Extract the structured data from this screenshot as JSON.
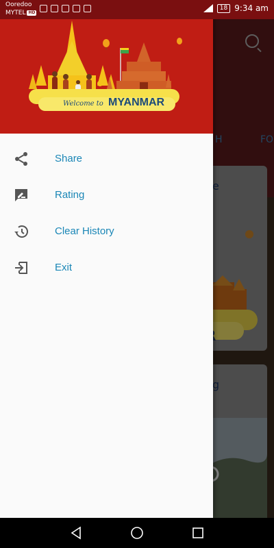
{
  "status_bar": {
    "carrier_1": "Ooredoo",
    "carrier_2": "MYTEL",
    "carrier_2_tag": "HD",
    "battery": "18",
    "time": "9:34 am"
  },
  "header": {
    "banner_script": "Welcome to",
    "banner_title": "MYANMAR"
  },
  "menu": {
    "items": [
      {
        "label": "Share",
        "icon": "share-icon"
      },
      {
        "label": "Rating",
        "icon": "rating-icon"
      },
      {
        "label": "Clear History",
        "icon": "history-icon"
      },
      {
        "label": "Exit",
        "icon": "exit-icon"
      }
    ]
  },
  "background": {
    "tab_partial_1": "H",
    "tab_partial_2": "FO",
    "card1_partial": "e",
    "card1_banner_partial": "R",
    "card2_partial": "g"
  },
  "colors": {
    "header_red": "#c01d14",
    "accent_blue": "#1a86b6",
    "banner_yellow": "#f6e04a"
  }
}
